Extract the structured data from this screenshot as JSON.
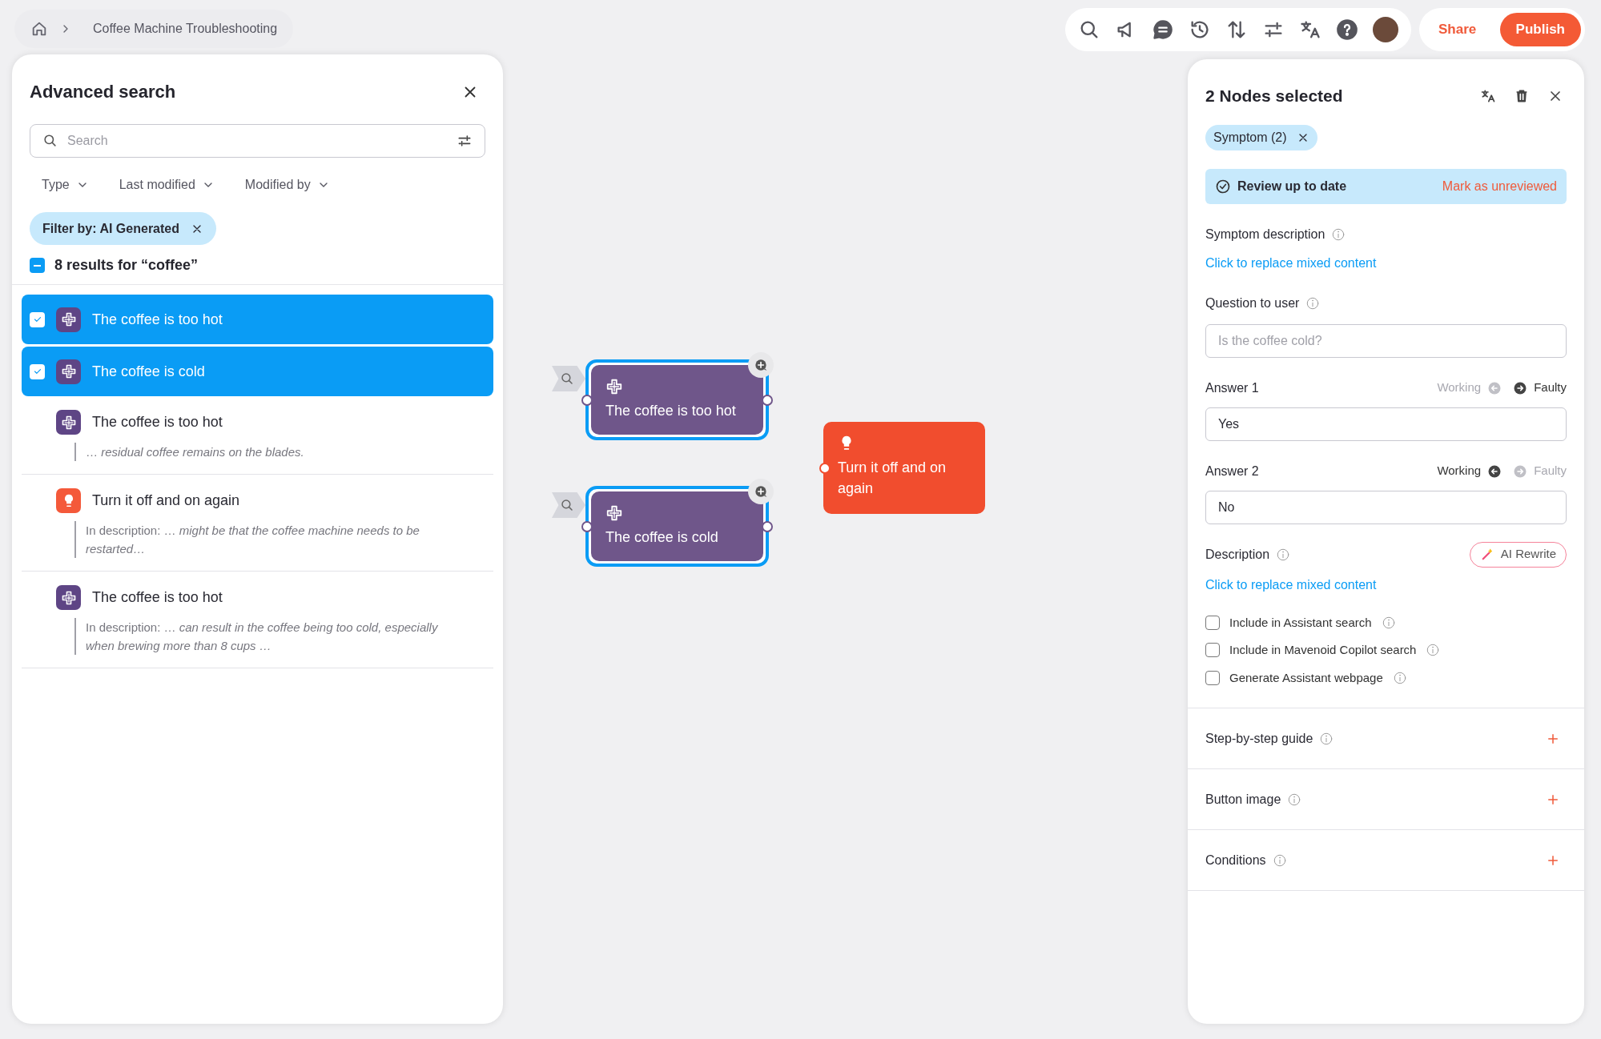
{
  "breadcrumb": {
    "items": [
      {
        "label": "Coffee Machine Troubleshooting"
      }
    ]
  },
  "top_actions": {
    "share": "Share",
    "publish": "Publish"
  },
  "advanced_search": {
    "title": "Advanced search",
    "search": {
      "placeholder": "Search"
    },
    "filters": [
      {
        "label": "Type"
      },
      {
        "label": "Last modified"
      },
      {
        "label": "Modified by"
      }
    ],
    "active_filter": {
      "label": "Filter by: AI Generated"
    },
    "select_all": {
      "indeterminate": true,
      "label": "8 results for “coffee”"
    },
    "results": [
      {
        "kind": "symptom",
        "title": "The coffee is too hot",
        "selected": true
      },
      {
        "kind": "symptom",
        "title": "The coffee is cold",
        "selected": true
      },
      {
        "kind": "symptom",
        "title": "The coffee is too hot",
        "selected": false,
        "snippet": "… *residual coffee remains on the blades.*"
      },
      {
        "kind": "solution",
        "title": "Turn it off and on again",
        "selected": false,
        "snippet": "In description: … *might be that the coffee machine needs to be restarted…*"
      },
      {
        "kind": "symptom",
        "title": "The coffee is too hot",
        "selected": false,
        "snippet": "In description: … *can result in the coffee being too cold, especially when brewing more than 8 cups …*"
      }
    ]
  },
  "canvas": {
    "nodes": [
      {
        "kind": "symptom",
        "label": "The coffee is too hot",
        "selected": true
      },
      {
        "kind": "symptom",
        "label": "The coffee is cold",
        "selected": true
      },
      {
        "kind": "solution",
        "label": "Turn it off and on again",
        "selected": false
      }
    ]
  },
  "details": {
    "title": "2 Nodes selected",
    "chip": "Symptom (2)",
    "review": {
      "label": "Review up to date",
      "action": "Mark as unreviewed"
    },
    "symptom_description": {
      "label": "Symptom description",
      "link": "Click to replace mixed content"
    },
    "question": {
      "label": "Question to user",
      "placeholder": "Is the coffee cold?"
    },
    "answers": [
      {
        "label": "Answer 1",
        "value": "Yes",
        "options": [
          {
            "label": "Working",
            "selected": false
          },
          {
            "label": "Faulty",
            "selected": true
          }
        ]
      },
      {
        "label": "Answer 2",
        "value": "No",
        "options": [
          {
            "label": "Working",
            "selected": true
          },
          {
            "label": "Faulty",
            "selected": false
          }
        ]
      }
    ],
    "description": {
      "label": "Description",
      "ai_button": "AI Rewrite",
      "link": "Click to replace mixed content"
    },
    "checkboxes": [
      {
        "label": "Include in Assistant search",
        "checked": false
      },
      {
        "label": "Include in Mavenoid Copilot search",
        "checked": false
      },
      {
        "label": "Generate Assistant webpage",
        "checked": false
      }
    ],
    "sections": [
      {
        "label": "Step-by-step guide"
      },
      {
        "label": "Button image"
      },
      {
        "label": "Conditions"
      }
    ]
  }
}
